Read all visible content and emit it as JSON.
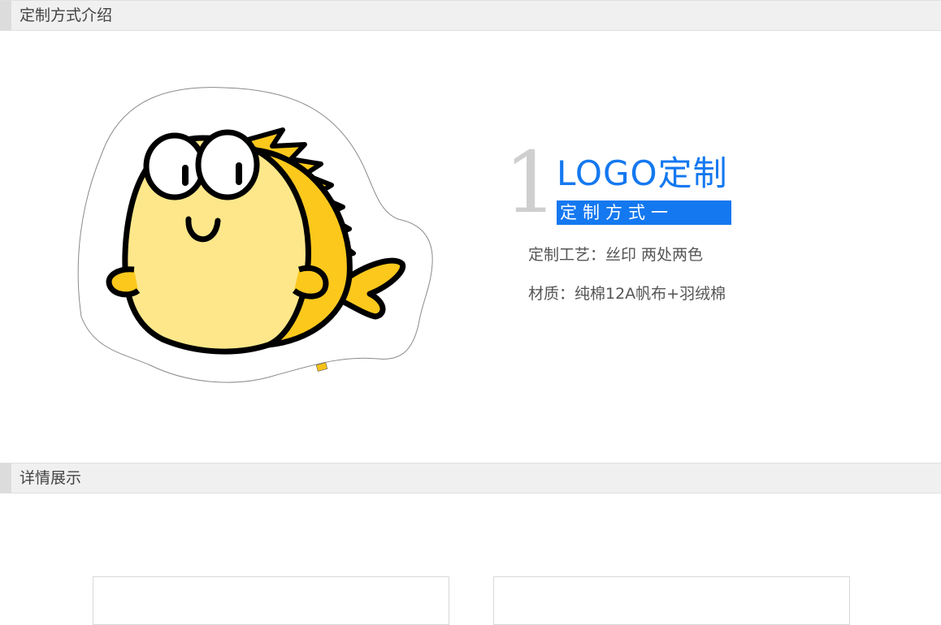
{
  "sections": {
    "intro_title": "定制方式介绍",
    "detail_title": "详情展示"
  },
  "method": {
    "number": "1",
    "title": "LOGO定制",
    "subtitle": "定制方式一",
    "craft": "定制工艺：丝印 两处两色",
    "material": "材质：纯棉12A帆布+羽绒棉"
  },
  "colors": {
    "accent_blue": "#1478f0",
    "fish_body": "#fde78a",
    "fish_fin": "#fcc81c"
  },
  "product_image": "yellow-fish-mascot-cushion"
}
